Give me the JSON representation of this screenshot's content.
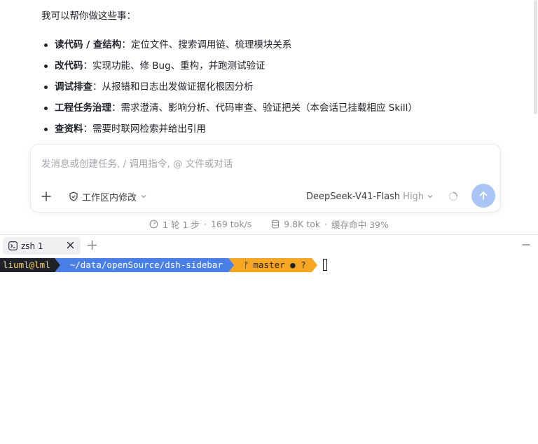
{
  "chat": {
    "intro": "我可以帮你做这些事：",
    "capabilities": [
      {
        "title": "读代码 / 查结构",
        "desc": "：定位文件、搜索调用链、梳理模块关系"
      },
      {
        "title": "改代码",
        "desc": "：实现功能、修 Bug、重构，并跑测试验证"
      },
      {
        "title": "调试排查",
        "desc": "：从报错和日志出发做证据化根因分析"
      },
      {
        "title": "工程任务治理",
        "desc": "：需求澄清、影响分析、代码审查、验证把关（本会话已挂载相应 Skill）"
      },
      {
        "title": "查资料",
        "desc": "：需要时联网检索并给出引用"
      }
    ]
  },
  "composer": {
    "placeholder": "发消息或创建任务, / 调用指令, @ 文件或对话",
    "value": "",
    "scope_label": "工作区内修改",
    "model_name": "DeepSeek-V41-Flash",
    "model_level": "High",
    "icons": {
      "add": "plus-icon",
      "scope": "shield-icon",
      "send": "arrow-up-icon"
    },
    "accent": "#a9c5f6"
  },
  "stats": {
    "rounds": "1 轮 1 步",
    "speed": "169 tok/s",
    "tokens": "9.8K tok",
    "cache": "缓存命中 39%",
    "sep": "·"
  },
  "terminal": {
    "tab_label": "zsh 1",
    "prompt": {
      "user": "liuml@lml",
      "path": "~/data/openSource/dsh-sidebar",
      "branch_symbol": "ᚠ",
      "branch": "master ● ?"
    },
    "colors": {
      "user_bg": "#1f2329",
      "user_fg": "#f3d170",
      "path_bg": "#4a7fe8",
      "git_bg": "#f6a623"
    }
  }
}
